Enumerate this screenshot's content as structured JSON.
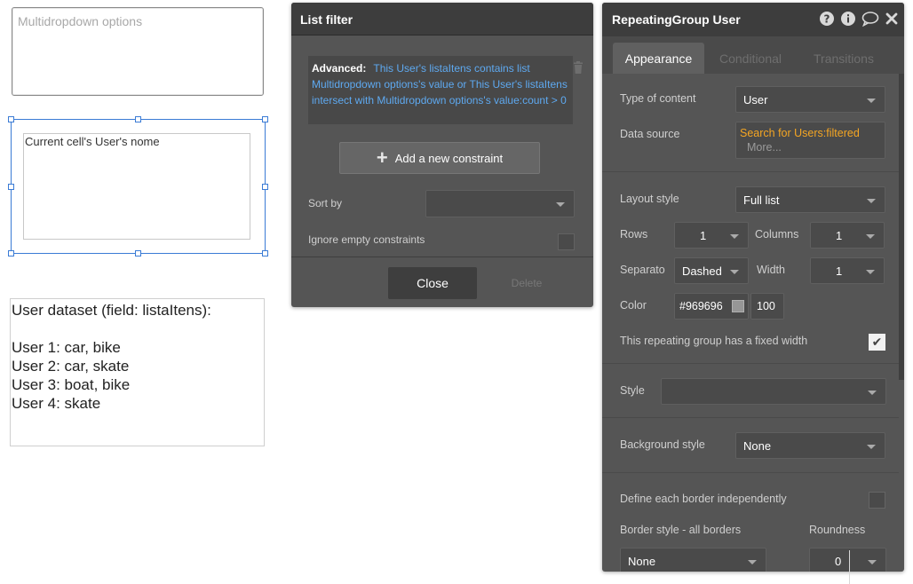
{
  "canvas": {
    "multidropdown_placeholder": "Multidropdown options",
    "cell_text": "Current cell's User's nome",
    "dataset_lines": [
      "User dataset (field: listaItens):",
      "",
      "User 1: car, bike",
      "User 2: car, skate",
      "User 3: boat, bike",
      "User 4: skate"
    ]
  },
  "list_filter": {
    "title": "List filter",
    "advanced_label": "Advanced:",
    "advanced_expression": "This User's listaItens contains list Multidropdown options's value or This User's listaItens intersect with Multidropdown options's value:count > 0",
    "add_constraint_label": "Add a new constraint",
    "sort_by_label": "Sort by",
    "sort_by_value": "",
    "ignore_empty_label": "Ignore empty constraints",
    "close_label": "Close",
    "delete_label": "Delete"
  },
  "property_editor": {
    "title": "RepeatingGroup User",
    "header_icons": [
      "help-icon",
      "info-icon",
      "comment-icon",
      "close-icon"
    ],
    "tabs": [
      {
        "label": "Appearance",
        "active": true
      },
      {
        "label": "Conditional",
        "active": false
      },
      {
        "label": "Transitions",
        "active": false
      }
    ],
    "type_of_content_label": "Type of content",
    "type_of_content_value": "User",
    "data_source_label": "Data source",
    "data_source_value": "Search for Users:filtered",
    "data_source_more": "More...",
    "layout_style_label": "Layout style",
    "layout_style_value": "Full list",
    "rows_label": "Rows",
    "rows_value": "1",
    "columns_label": "Columns",
    "columns_value": "1",
    "separator_label": "Separato",
    "separator_value": "Dashed",
    "width_label": "Width",
    "width_value": "1",
    "color_label": "Color",
    "color_value": "#969696",
    "opacity_value": "100",
    "fixed_width_label": "This repeating group has a fixed width",
    "fixed_width_checked": true,
    "style_label": "Style",
    "style_value": "",
    "background_style_label": "Background style",
    "background_style_value": "None",
    "border_independent_label": "Define each border independently",
    "border_style_label": "Border style - all borders",
    "border_style_value": "None",
    "roundness_label": "Roundness",
    "roundness_value": "0"
  },
  "colors": {
    "panel_bg": "#555555",
    "panel_header": "#3d3d3d",
    "link_blue": "#5ea9f0",
    "data_source_orange": "#f5a623",
    "selection_blue": "#3a7bd5"
  }
}
